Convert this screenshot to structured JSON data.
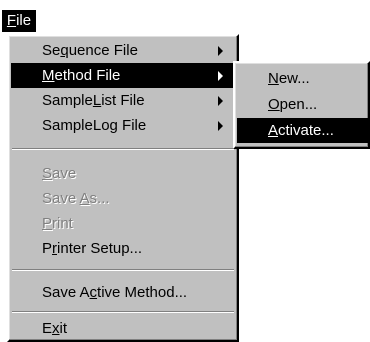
{
  "menubar": {
    "file": {
      "pre": "",
      "key": "F",
      "post": "ile"
    }
  },
  "menu": {
    "sequence_file": {
      "pre": "Se",
      "key": "q",
      "post": "uence File"
    },
    "method_file": {
      "pre": "",
      "key": "M",
      "post": "ethod File"
    },
    "samplelist_file": {
      "pre": "Sample",
      "key": "L",
      "post": "ist File"
    },
    "samplelog_file": {
      "pre": "SampleLo",
      "key": "g",
      "post": " File"
    },
    "save": {
      "pre": "",
      "key": "S",
      "post": "ave"
    },
    "save_as": {
      "pre": "Save ",
      "key": "A",
      "post": "s..."
    },
    "print": {
      "pre": "",
      "key": "P",
      "post": "rint"
    },
    "printer_setup": {
      "pre": "P",
      "key": "r",
      "post": "inter Setup..."
    },
    "save_active_method": {
      "pre": "Save A",
      "key": "c",
      "post": "tive Method..."
    },
    "exit": {
      "pre": "E",
      "key": "x",
      "post": "it"
    }
  },
  "submenu": {
    "new": {
      "pre": "",
      "key": "N",
      "post": "ew..."
    },
    "open": {
      "pre": "",
      "key": "O",
      "post": "pen..."
    },
    "activate": {
      "pre": "",
      "key": "A",
      "post": "ctivate..."
    }
  }
}
